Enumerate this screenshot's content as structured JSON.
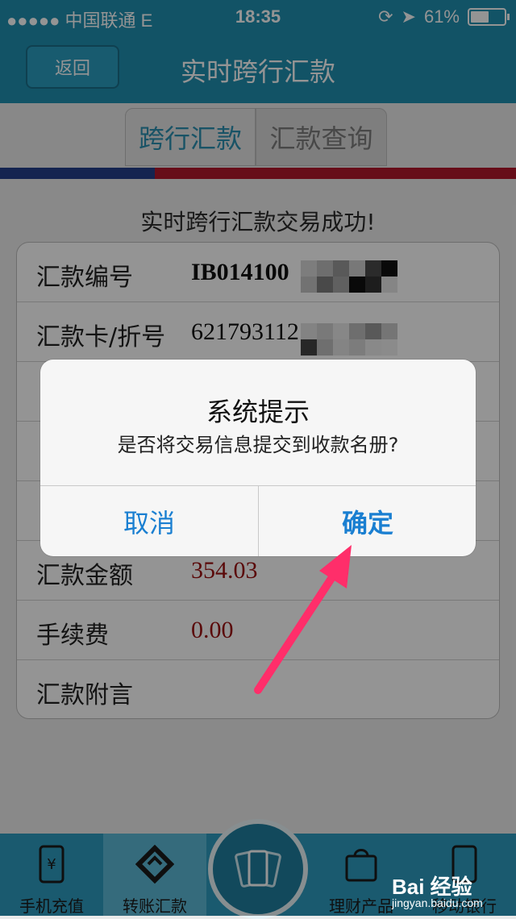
{
  "status_bar": {
    "carrier": "●●●●● 中国联通  E",
    "time": "18:35",
    "battery_percent": "61%",
    "battery_level": 0.61
  },
  "nav": {
    "back_label": "返回",
    "title": "实时跨行汇款"
  },
  "tabs": [
    {
      "label": "跨行汇款",
      "active": true
    },
    {
      "label": "汇款查询",
      "active": false
    }
  ],
  "main": {
    "success_message": "实时跨行汇款交易成功!",
    "rows": [
      {
        "label": "汇款编号",
        "value": "IB014100"
      },
      {
        "label": "汇款卡/折号",
        "value": "621793112"
      },
      {
        "label": "",
        "value": ""
      },
      {
        "label": "",
        "value": ""
      },
      {
        "label": "",
        "value": ""
      },
      {
        "label": "汇款金额",
        "value": "354.03"
      },
      {
        "label": "手续费",
        "value": "0.00"
      },
      {
        "label": "汇款附言",
        "value": ""
      }
    ]
  },
  "dialog": {
    "title": "系统提示",
    "message": "是否将交易信息提交到收款名册?",
    "cancel_label": "取消",
    "confirm_label": "确定"
  },
  "bottom_nav": {
    "items": [
      {
        "label": "手机充值"
      },
      {
        "label": "转账汇款"
      },
      {
        "label": "理财产品"
      },
      {
        "label": "移动银行"
      }
    ]
  },
  "watermark": {
    "logo_text": "Bai 经验",
    "site": "jingyan.baidu.com"
  },
  "colors": {
    "accent": "#1f8fb0",
    "stripe_blue": "#233f8a",
    "stripe_red": "#b2182b",
    "amount_red": "#9b1010",
    "dialog_button": "#1a7fd1",
    "arrow": "#ff2e6a"
  }
}
